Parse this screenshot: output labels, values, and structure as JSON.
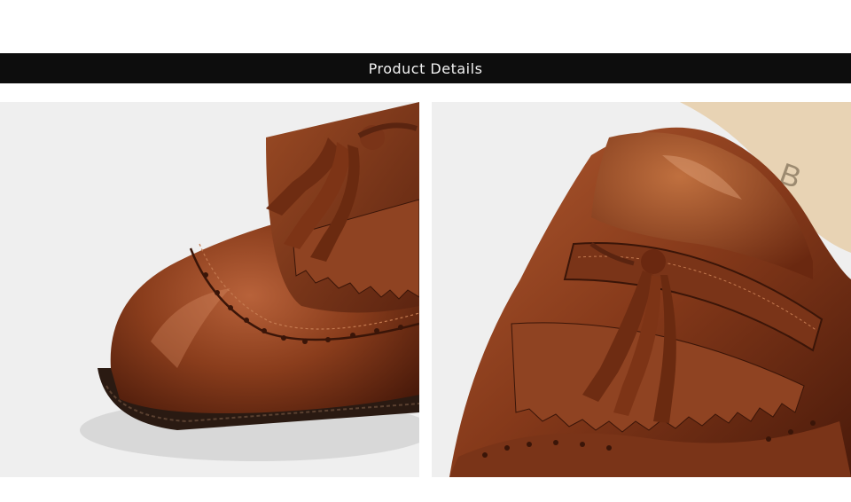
{
  "header": {
    "title": "Product Details"
  },
  "photos": [
    {
      "name": "toe-closeup",
      "brand_mark": ""
    },
    {
      "name": "tassel-closeup",
      "brand_mark": "B"
    }
  ],
  "colors": {
    "banner": "#0d0d0d",
    "leather": "#7a3418",
    "background": "#efefef"
  }
}
